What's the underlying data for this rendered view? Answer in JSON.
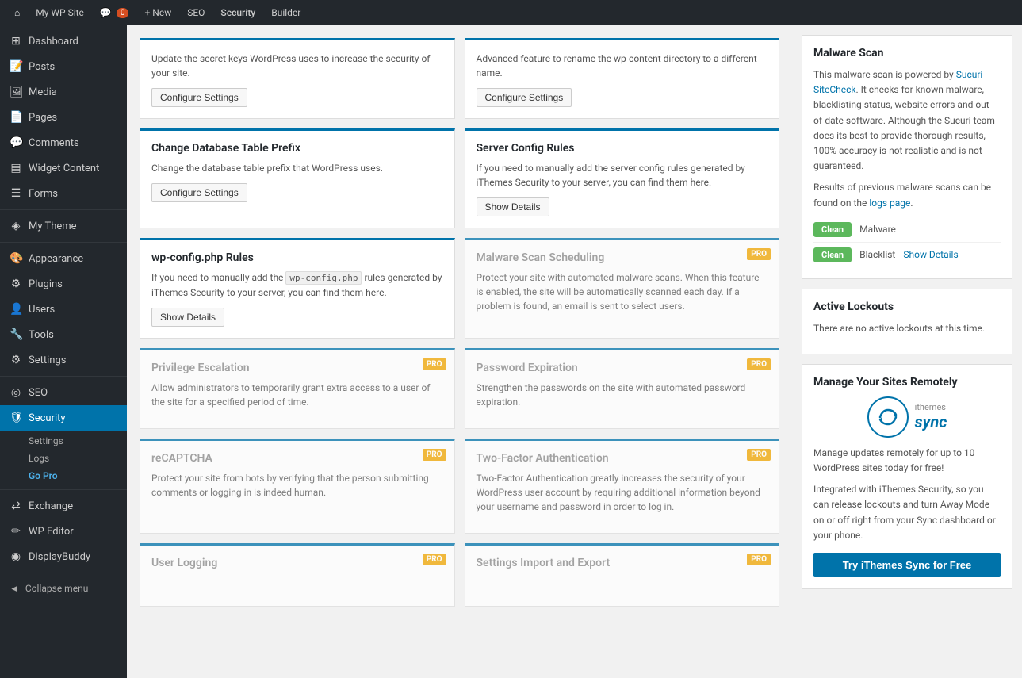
{
  "adminBar": {
    "siteIcon": "⌂",
    "siteName": "My WP Site",
    "notifIcon": "💬",
    "notifCount": "0",
    "newLabel": "+ New",
    "seoLabel": "SEO",
    "securityLabel": "Security",
    "builderLabel": "Builder"
  },
  "sidebar": {
    "items": [
      {
        "id": "dashboard",
        "icon": "⊞",
        "label": "Dashboard"
      },
      {
        "id": "posts",
        "icon": "📝",
        "label": "Posts"
      },
      {
        "id": "media",
        "icon": "🖼",
        "label": "Media"
      },
      {
        "id": "pages",
        "icon": "📄",
        "label": "Pages"
      },
      {
        "id": "comments",
        "icon": "💬",
        "label": "Comments"
      },
      {
        "id": "widget-content",
        "icon": "▤",
        "label": "Widget Content"
      },
      {
        "id": "forms",
        "icon": "☰",
        "label": "Forms"
      },
      {
        "id": "my-theme",
        "icon": "◈",
        "label": "My Theme"
      },
      {
        "id": "appearance",
        "icon": "🎨",
        "label": "Appearance"
      },
      {
        "id": "plugins",
        "icon": "⚙",
        "label": "Plugins"
      },
      {
        "id": "users",
        "icon": "👤",
        "label": "Users"
      },
      {
        "id": "tools",
        "icon": "🔧",
        "label": "Tools"
      },
      {
        "id": "settings",
        "icon": "⚙",
        "label": "Settings"
      },
      {
        "id": "seo",
        "icon": "◎",
        "label": "SEO"
      },
      {
        "id": "security",
        "icon": "🛡",
        "label": "Security"
      }
    ],
    "securitySub": [
      {
        "id": "settings-sub",
        "label": "Settings",
        "active": false
      },
      {
        "id": "logs-sub",
        "label": "Logs",
        "active": false
      },
      {
        "id": "gopro-sub",
        "label": "Go Pro",
        "active": true,
        "gopro": true
      }
    ],
    "otherItems": [
      {
        "id": "exchange",
        "icon": "⇄",
        "label": "Exchange"
      },
      {
        "id": "wp-editor",
        "icon": "✏",
        "label": "WP Editor"
      },
      {
        "id": "displaybuddy",
        "icon": "◉",
        "label": "DisplayBuddy"
      }
    ],
    "collapseLabel": "Collapse menu"
  },
  "cards": [
    {
      "id": "change-db-prefix",
      "title": "Change Database Table Prefix",
      "description": "Change the database table prefix that WordPress uses.",
      "buttonLabel": "Configure Settings",
      "pro": false,
      "borderColor": "#0073aa"
    },
    {
      "id": "server-config-rules",
      "title": "Server Config Rules",
      "description": "If you need to manually add the server config rules generated by iThemes Security to your server, you can find them here.",
      "buttonLabel": "Show Details",
      "pro": false,
      "borderColor": "#0073aa"
    },
    {
      "id": "wp-config-rules",
      "title": "wp-config.php Rules",
      "description": "If you need to manually add the wp-config.php rules generated by iThemes Security to your server, you can find them here.",
      "buttonLabel": "Show Details",
      "pro": false,
      "codeLabel": "wp-config.php",
      "borderColor": "#0073aa"
    },
    {
      "id": "malware-scan-scheduling",
      "title": "Malware Scan Scheduling",
      "description": "Protect your site with automated malware scans. When this feature is enabled, the site will be automatically scanned each day. If a problem is found, an email is sent to select users.",
      "buttonLabel": null,
      "pro": true,
      "borderColor": "#aaa"
    },
    {
      "id": "privilege-escalation",
      "title": "Privilege Escalation",
      "description": "Allow administrators to temporarily grant extra access to a user of the site for a specified period of time.",
      "buttonLabel": null,
      "pro": true,
      "borderColor": "#aaa"
    },
    {
      "id": "password-expiration",
      "title": "Password Expiration",
      "description": "Strengthen the passwords on the site with automated password expiration.",
      "buttonLabel": null,
      "pro": true,
      "borderColor": "#aaa"
    },
    {
      "id": "recaptcha",
      "title": "reCAPTCHA",
      "description": "Protect your site from bots by verifying that the person submitting comments or logging in is indeed human.",
      "buttonLabel": null,
      "pro": true,
      "borderColor": "#aaa"
    },
    {
      "id": "two-factor-auth",
      "title": "Two-Factor Authentication",
      "description": "Two-Factor Authentication greatly increases the security of your WordPress user account by requiring additional information beyond your username and password in order to log in.",
      "buttonLabel": null,
      "pro": true,
      "borderColor": "#aaa"
    },
    {
      "id": "user-logging",
      "title": "User Logging",
      "description": "",
      "buttonLabel": null,
      "pro": true,
      "borderColor": "#aaa"
    },
    {
      "id": "settings-import-export",
      "title": "Settings Import and Export",
      "description": "",
      "buttonLabel": null,
      "pro": true,
      "borderColor": "#aaa"
    }
  ],
  "malwareScan": {
    "title": "Malware Scan",
    "intro": "This malware scan is powered by ",
    "sucuriLink": "Sucuri SiteCheck",
    "introAfter": ". It checks for known malware, blacklisting status, website errors and out-of-date software. Although the Sucuri team does its best to provide thorough results, 100% accuracy is not realistic and is not guaranteed.",
    "logsText": "Results of previous malware scans can be found on the ",
    "logsLink": "logs page",
    "rows": [
      {
        "status": "Clean",
        "label": "Malware"
      },
      {
        "status": "Clean",
        "label": "Blacklist",
        "showDetails": "Show Details"
      }
    ]
  },
  "activeLockouts": {
    "title": "Active Lockouts",
    "text": "There are no active lockouts at this time."
  },
  "manageSync": {
    "title": "Manage Your Sites Remotely",
    "syncBrand": "ithemes",
    "syncName": "sync",
    "desc1": "Manage updates remotely for up to 10 WordPress sites today for free!",
    "desc2": "Integrated with iThemes Security, so you can release lockouts and turn Away Mode on or off right from your Sync dashboard or your phone.",
    "btnLabel": "Try iThemes Sync for Free"
  },
  "topCards": [
    {
      "id": "secret-keys",
      "description": "Update the secret keys WordPress uses to increase the security of your site.",
      "buttonLabel": "Configure Settings"
    },
    {
      "id": "rename-content-dir",
      "description": "Advanced feature to rename the wp-content directory to a different name.",
      "buttonLabel": "Configure Settings"
    }
  ]
}
